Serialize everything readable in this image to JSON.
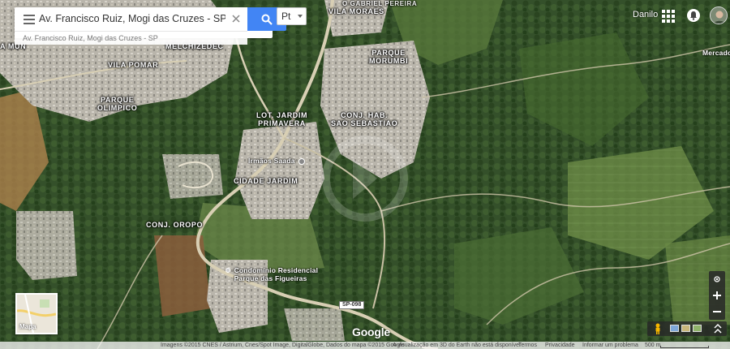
{
  "search": {
    "query": "Av. Francisco Ruiz, Mogi das Cruzes - SP",
    "suggestion": "Av. Francisco Ruiz, Mogi das Cruzes - SP"
  },
  "language_select": {
    "selected": "Pt"
  },
  "header": {
    "user_name": "Danilo"
  },
  "neighborhoods": [
    {
      "id": "vila-moraes",
      "label": "VILA MORAES"
    },
    {
      "id": "vila-pomar",
      "label": "VILA POMAR"
    },
    {
      "id": "melchizedec",
      "label": "MELCHIZEDEC"
    },
    {
      "id": "parque-olimpico",
      "label": "PARQUE\nOLIMPICO"
    },
    {
      "id": "parque-morumbi",
      "label": "PARQUE\nMORUMBI"
    },
    {
      "id": "lot-jardim-primavera",
      "label": "LOT. JARDIM\nPRIMAVERA"
    },
    {
      "id": "conj-hab-sao-sebastiao",
      "label": "CONJ. HAB.\nSAO SEBASTIAO"
    },
    {
      "id": "cidade-jardim",
      "label": "CIDADE JARDIM"
    },
    {
      "id": "conj-oropo",
      "label": "CONJ. OROPO"
    },
    {
      "id": "a-mun",
      "label": "A MUN"
    },
    {
      "id": "parque-do-caucaia",
      "label": "O GABRIEL PEREIRA"
    }
  ],
  "pois": [
    {
      "id": "irmaos-saada",
      "label": "Irmãos Saada"
    },
    {
      "id": "condominio",
      "label": "Condomínio Residencial\nParque das Figueiras"
    },
    {
      "id": "mercado",
      "label": "Mercado O"
    }
  ],
  "road_shield": "SP-098",
  "minimap": {
    "label": "Mapa"
  },
  "branding": {
    "logo": "Google"
  },
  "footer": {
    "imagery": "Imagens ©2015 CNES / Astrium, Cnes/Spot Image, DigitalGlobe, Dados do mapa ©2015 Google",
    "earth_notice": "A visualização em 3D do Earth não está disponível",
    "terms": "Termos",
    "privacy": "Privacidade",
    "report": "Informar um problema",
    "scale": "500 m"
  },
  "colors": {
    "search_button": "#4285f4",
    "vegetation_dark": "#2e4a22",
    "vegetation_light": "#5d7a3f",
    "urban": "#a6a39a",
    "road": "#d8cfb4"
  },
  "icons": {
    "menu": "hamburger-icon",
    "clear": "close-icon",
    "search": "search-icon",
    "apps": "apps-grid-icon",
    "notifications": "bell-icon",
    "location": "my-location-icon",
    "zoom_in": "plus-icon",
    "zoom_out": "minus-icon",
    "pegman": "pegman-icon",
    "fullscreen": "expand-icon"
  }
}
